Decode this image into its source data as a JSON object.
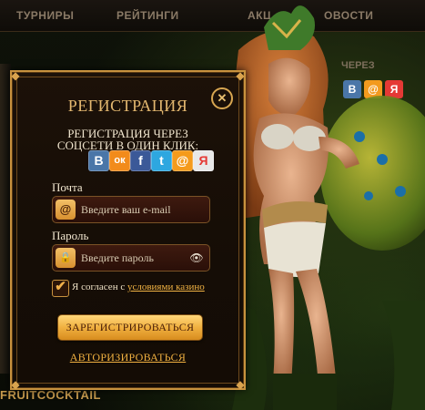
{
  "nav": {
    "items": [
      "ТУРНИРЫ",
      "РЕЙТИНГИ",
      "АКЦ",
      "ОВОСТИ"
    ]
  },
  "sidebar": {
    "social_label": "ЧЕРЕЗ",
    "icons": [
      {
        "name": "vk-icon",
        "glyph": "В",
        "color": "#4a76a8"
      },
      {
        "name": "mail-icon",
        "glyph": "@",
        "color": "#f39a1e"
      },
      {
        "name": "yandex-icon",
        "glyph": "Я",
        "color": "#e53935"
      }
    ]
  },
  "bottom_logo": "FRUITCOCKTAIL",
  "modal": {
    "title": "РЕГИСТРАЦИЯ",
    "close_glyph": "✕",
    "subtitle_line1": "РЕГИСТРАЦИЯ ЧЕРЕЗ",
    "subtitle_line2": "СОЦСЕТИ В ОДИН КЛИК:",
    "socials": [
      {
        "name": "vk-icon",
        "glyph": "В",
        "color": "#4a76a8"
      },
      {
        "name": "odnoklassniki-icon",
        "glyph": "ок",
        "color": "#f28b1b"
      },
      {
        "name": "facebook-icon",
        "glyph": "f",
        "color": "#3b5998"
      },
      {
        "name": "twitter-icon",
        "glyph": "t",
        "color": "#2da7e0"
      },
      {
        "name": "mailru-icon",
        "glyph": "@",
        "color": "#f59b1c"
      },
      {
        "name": "yandex-icon",
        "glyph": "Я",
        "color": "#e8e8e8"
      }
    ],
    "email_label": "Почта",
    "email_icon": "@",
    "email_placeholder": "Введите ваш e-mail",
    "password_label": "Пароль",
    "password_icon": "🔒",
    "password_placeholder": "Введите пароль",
    "eye_glyph": "👁",
    "agree_checked": "✔",
    "agree_text": "Я согласен с ",
    "agree_link": "условиями казино",
    "register_button": "ЗАРЕГИСТРИРОВАТЬСЯ",
    "auth_link": "АВТОРИЗИРОВАТЬСЯ"
  },
  "colors": {
    "accent_gold": "#e4b870",
    "button_gold": "#f0b040",
    "field_bg": "#3e1a0f"
  }
}
